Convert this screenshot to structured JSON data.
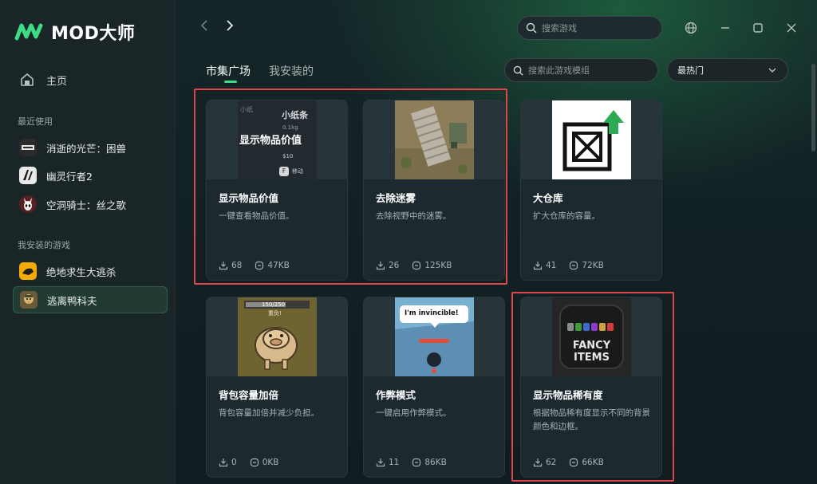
{
  "app": {
    "logo_text": "MOD大师"
  },
  "sidebar": {
    "home_label": "主页",
    "recent_title": "最近使用",
    "recent_games": [
      {
        "label": "消逝的光芒：困兽",
        "icon": "dying-light-icon"
      },
      {
        "label": "幽灵行者2",
        "icon": "ghostrunner-icon"
      },
      {
        "label": "空洞骑士：丝之歌",
        "icon": "hollow-knight-icon"
      }
    ],
    "installed_title": "我安装的游戏",
    "installed_games": [
      {
        "label": "绝地求生大逃杀",
        "icon": "pubg-icon"
      },
      {
        "label": "逃离鸭科夫",
        "icon": "duckov-icon",
        "active": true
      }
    ]
  },
  "topbar": {
    "search_placeholder": "搜索游戏"
  },
  "tabs": [
    {
      "label": "市集广场",
      "active": true
    },
    {
      "label": "我安装的",
      "active": false
    }
  ],
  "filters": {
    "search_placeholder": "搜索此游戏模组",
    "sort_value": "最热门"
  },
  "cards": [
    {
      "title": "显示物品价值",
      "desc": "一键查看物品价值。",
      "downloads": "68",
      "size": "47KB",
      "thumb_lines": [
        "小纸条",
        "0.1kg",
        "显示物品价值",
        "$10",
        "F",
        "移动",
        "小纸"
      ]
    },
    {
      "title": "去除迷雾",
      "desc": "去除视野中的迷雾。",
      "downloads": "26",
      "size": "125KB"
    },
    {
      "title": "大仓库",
      "desc": "扩大仓库的容量。",
      "downloads": "41",
      "size": "72KB"
    },
    {
      "title": "背包容量加倍",
      "desc": "背包容量加倍并减少负担。",
      "downloads": "0",
      "size": "0KB",
      "thumb_lines": [
        "150/250",
        "重负!"
      ]
    },
    {
      "title": "作弊模式",
      "desc": "一键启用作弊模式。",
      "downloads": "11",
      "size": "86KB",
      "thumb_lines": [
        "I'm invincible!"
      ]
    },
    {
      "title": "显示物品稀有度",
      "desc": "根据物品稀有度显示不同的背景颜色和边框。",
      "downloads": "62",
      "size": "66KB",
      "thumb_lines": [
        "FANCY",
        "ITEMS"
      ]
    }
  ],
  "colors": {
    "accent": "#3ddc84",
    "highlight": "#e0474c",
    "card_bg": "#1c2a30"
  }
}
